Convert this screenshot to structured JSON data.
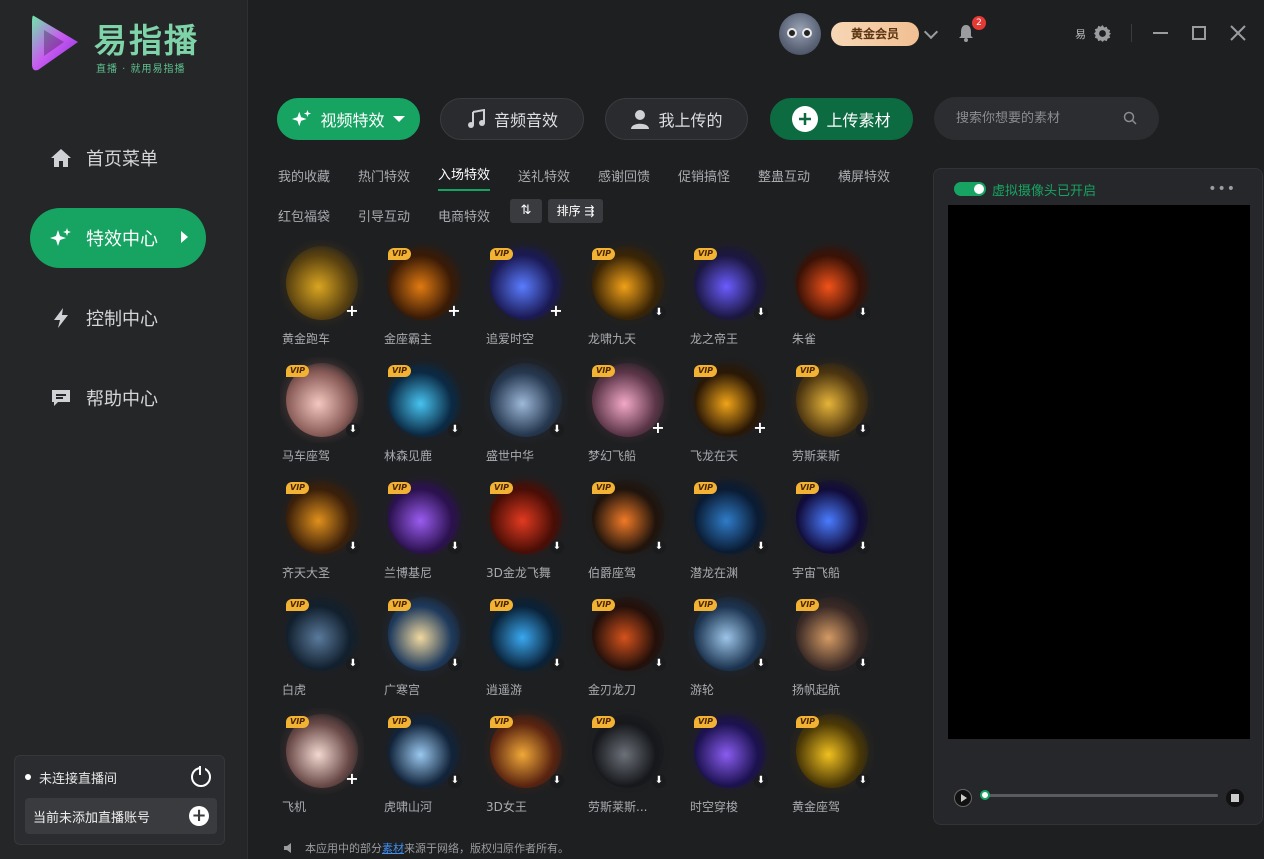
{
  "app": {
    "title": "易指播",
    "slogan": "直播 · 就用易指播"
  },
  "sidebar": {
    "items": [
      {
        "label": "首页菜单",
        "icon": "home-icon",
        "active": false
      },
      {
        "label": "特效中心",
        "icon": "sparkle-icon",
        "active": true
      },
      {
        "label": "控制中心",
        "icon": "lightning-icon",
        "active": false
      },
      {
        "label": "帮助中心",
        "icon": "chat-icon",
        "active": false
      }
    ],
    "status_text": "未连接直播间",
    "account_text": "当前未添加直播账号"
  },
  "topbar": {
    "membership": "黄金会员",
    "notifications": "2",
    "settings_label": "易"
  },
  "toolbar": {
    "video_effects": "视频特效",
    "audio_effects": "音频音效",
    "my_uploads": "我上传的",
    "upload": "上传素材",
    "search_placeholder": "搜索你想要的素材"
  },
  "categories": [
    "我的收藏",
    "热门特效",
    "入场特效",
    "送礼特效",
    "感谢回馈",
    "促销搞怪",
    "整蛊互动",
    "横屏特效",
    "红包福袋",
    "引导互动",
    "电商特效"
  ],
  "active_category": "入场特效",
  "sort": {
    "toggle": "⇅",
    "label": "排序 ⇶"
  },
  "grid_items": [
    {
      "name": "黄金跑车",
      "vip": false,
      "action": "add",
      "colors": [
        "#d9a521",
        "#5a4210"
      ]
    },
    {
      "name": "金座霸主",
      "vip": true,
      "action": "add",
      "colors": [
        "#e07a12",
        "#3a1b06"
      ]
    },
    {
      "name": "追爱时空",
      "vip": true,
      "action": "add",
      "colors": [
        "#5a7cff",
        "#1b1a55"
      ]
    },
    {
      "name": "龙啸九天",
      "vip": true,
      "action": "download",
      "colors": [
        "#f0a018",
        "#3a2506"
      ]
    },
    {
      "name": "龙之帝王",
      "vip": true,
      "action": "download",
      "colors": [
        "#6b5cff",
        "#1b1740"
      ]
    },
    {
      "name": "朱雀",
      "vip": false,
      "action": "download",
      "colors": [
        "#f2521a",
        "#3a1206"
      ]
    },
    {
      "name": "马车座驾",
      "vip": true,
      "action": "download",
      "colors": [
        "#f4c8c0",
        "#8a5c58"
      ]
    },
    {
      "name": "林森见鹿",
      "vip": true,
      "action": "download",
      "colors": [
        "#47c3f0",
        "#0b2a44"
      ]
    },
    {
      "name": "盛世中华",
      "vip": false,
      "action": "download",
      "colors": [
        "#9db8d8",
        "#263850"
      ]
    },
    {
      "name": "梦幻飞船",
      "vip": true,
      "action": "add",
      "colors": [
        "#f3a8c8",
        "#5c3648"
      ]
    },
    {
      "name": "飞龙在天",
      "vip": true,
      "action": "add",
      "colors": [
        "#f0a418",
        "#2a1806"
      ]
    },
    {
      "name": "劳斯莱斯",
      "vip": true,
      "action": "download",
      "colors": [
        "#e6b43a",
        "#4c3510"
      ]
    },
    {
      "name": "齐天大圣",
      "vip": true,
      "action": "download",
      "colors": [
        "#e0901c",
        "#3b200a"
      ]
    },
    {
      "name": "兰博基尼",
      "vip": true,
      "action": "download",
      "colors": [
        "#9b5cf0",
        "#2c1250"
      ]
    },
    {
      "name": "3D金龙飞舞",
      "vip": true,
      "action": "download",
      "colors": [
        "#e23a20",
        "#4a0e06"
      ]
    },
    {
      "name": "伯爵座驾",
      "vip": true,
      "action": "download",
      "colors": [
        "#f07a28",
        "#20140c"
      ]
    },
    {
      "name": "潜龙在渊",
      "vip": true,
      "action": "download",
      "colors": [
        "#2f7cc8",
        "#0a1c34"
      ]
    },
    {
      "name": "宇宙飞船",
      "vip": true,
      "action": "download",
      "colors": [
        "#4a7cff",
        "#110c3a"
      ]
    },
    {
      "name": "白虎",
      "vip": true,
      "action": "download",
      "colors": [
        "#5a7a9c",
        "#12202e"
      ]
    },
    {
      "name": "广寒宫",
      "vip": true,
      "action": "download",
      "colors": [
        "#f0d8a0",
        "#1e3a5c"
      ]
    },
    {
      "name": "逍遥游",
      "vip": true,
      "action": "download",
      "colors": [
        "#3aa8f0",
        "#0a2238"
      ]
    },
    {
      "name": "金刃龙刀",
      "vip": true,
      "action": "download",
      "colors": [
        "#d4521c",
        "#24100a"
      ]
    },
    {
      "name": "游轮",
      "vip": true,
      "action": "download",
      "colors": [
        "#9cc4e8",
        "#1c3450"
      ]
    },
    {
      "name": "扬帆起航",
      "vip": true,
      "action": "download",
      "colors": [
        "#d49a64",
        "#3a2a26"
      ]
    },
    {
      "name": "飞机",
      "vip": true,
      "action": "add",
      "colors": [
        "#f2d8d0",
        "#6a4a48"
      ]
    },
    {
      "name": "虎啸山河",
      "vip": true,
      "action": "download",
      "colors": [
        "#9ac8f0",
        "#12243a"
      ]
    },
    {
      "name": "3D女王",
      "vip": true,
      "action": "download",
      "colors": [
        "#f0a838",
        "#5a2410"
      ]
    },
    {
      "name": "劳斯莱斯...",
      "vip": true,
      "action": "download",
      "colors": [
        "#6c7078",
        "#16181c"
      ]
    },
    {
      "name": "时空穿梭",
      "vip": true,
      "action": "download",
      "colors": [
        "#8a5cf0",
        "#1c1250"
      ]
    },
    {
      "name": "黄金座驾",
      "vip": true,
      "action": "download",
      "colors": [
        "#f0c020",
        "#4a3806"
      ]
    }
  ],
  "footer": {
    "before": "本应用中的部分",
    "link": "素材",
    "after": "来源于网络，版权归原作者所有。"
  },
  "preview": {
    "camera_label": "虚拟摄像头已开启",
    "more": "•••"
  },
  "colors": {
    "accent": "#17a463",
    "background": "#1e1f21"
  }
}
